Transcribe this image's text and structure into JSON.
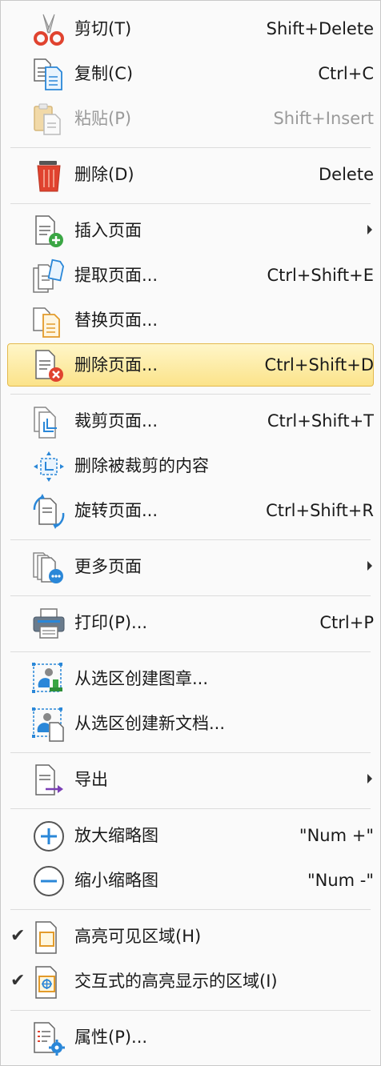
{
  "menu": {
    "cut": {
      "label": "剪切(T)",
      "shortcut": "Shift+Delete",
      "icon": "scissors-icon"
    },
    "copy": {
      "label": "复制(C)",
      "shortcut": "Ctrl+C",
      "icon": "copy-icon"
    },
    "paste": {
      "label": "粘贴(P)",
      "shortcut": "Shift+Insert",
      "icon": "paste-icon",
      "disabled": true
    },
    "delete": {
      "label": "删除(D)",
      "shortcut": "Delete",
      "icon": "trash-icon"
    },
    "insert_pages": {
      "label": "插入页面",
      "icon": "insert-page-icon",
      "submenu": true
    },
    "extract_pages": {
      "label": "提取页面...",
      "shortcut": "Ctrl+Shift+E",
      "icon": "extract-pages-icon"
    },
    "replace_pages": {
      "label": "替换页面...",
      "icon": "replace-pages-icon"
    },
    "delete_pages": {
      "label": "删除页面...",
      "shortcut": "Ctrl+Shift+D",
      "icon": "delete-page-icon",
      "highlighted": true
    },
    "crop_pages": {
      "label": "裁剪页面...",
      "shortcut": "Ctrl+Shift+T",
      "icon": "crop-pages-icon"
    },
    "delete_cropped": {
      "label": "删除被裁剪的内容",
      "icon": "remove-crop-icon"
    },
    "rotate_pages": {
      "label": "旋转页面...",
      "shortcut": "Ctrl+Shift+R",
      "icon": "rotate-pages-icon"
    },
    "more_pages": {
      "label": "更多页面",
      "icon": "more-pages-icon",
      "submenu": true
    },
    "print": {
      "label": "打印(P)...",
      "shortcut": "Ctrl+P",
      "icon": "printer-icon"
    },
    "create_stamp": {
      "label": "从选区创建图章...",
      "icon": "stamp-from-selection-icon"
    },
    "create_document": {
      "label": "从选区创建新文档...",
      "icon": "document-from-selection-icon"
    },
    "export": {
      "label": "导出",
      "icon": "export-icon",
      "submenu": true
    },
    "zoom_in": {
      "label": "放大缩略图",
      "shortcut": "\"Num +\"",
      "icon": "plus-circle-icon"
    },
    "zoom_out": {
      "label": "缩小缩略图",
      "shortcut": "\"Num -\"",
      "icon": "minus-circle-icon"
    },
    "highlight_visible": {
      "label": "高亮可见区域(H)",
      "icon": "highlight-area-icon",
      "checked": true
    },
    "interactive_highlight": {
      "label": "交互式的高亮显示的区域(I)",
      "icon": "interactive-highlight-icon",
      "checked": true
    },
    "properties": {
      "label": "属性(P)...",
      "icon": "properties-icon"
    }
  },
  "colors": {
    "highlight_bg": "#fbe38a",
    "highlight_border": "#e3b94d",
    "separator": "#dcdcdc",
    "accent_blue": "#2a87d8",
    "accent_red": "#e0432f",
    "accent_green": "#3aa644"
  }
}
